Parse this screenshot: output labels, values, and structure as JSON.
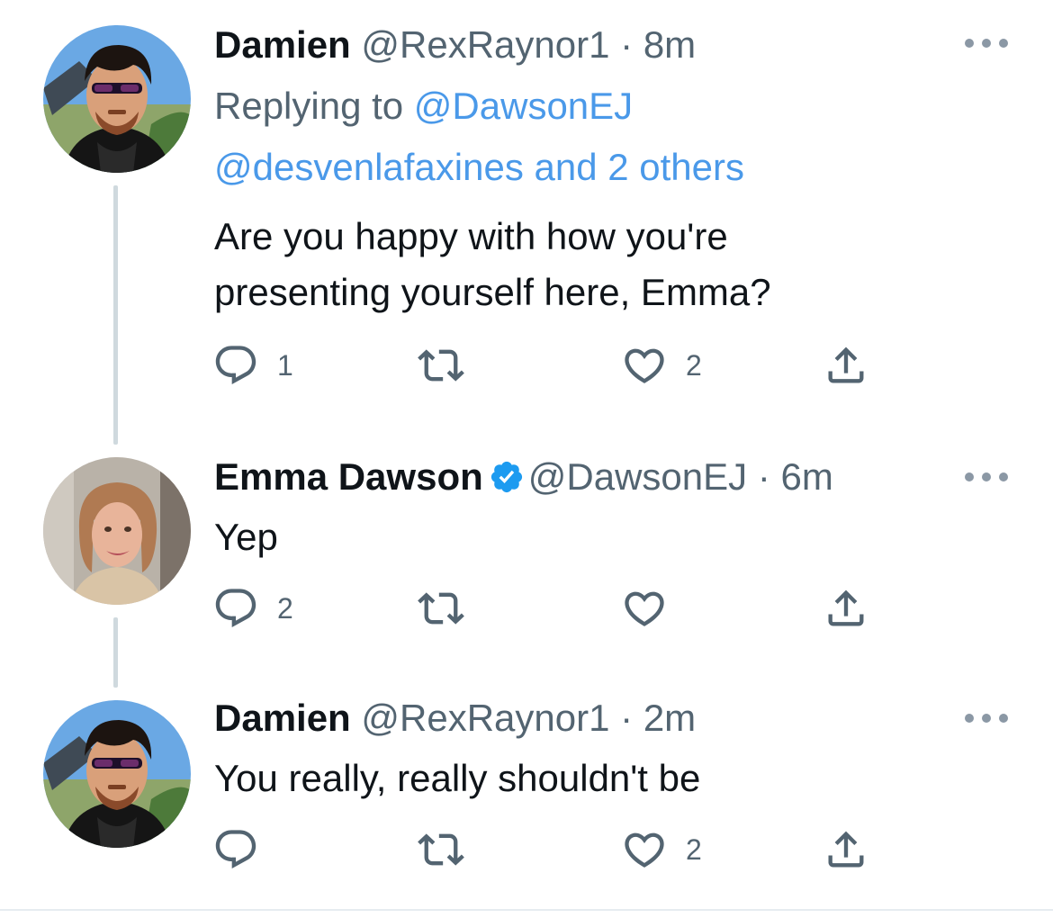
{
  "tweets": [
    {
      "name": "Damien",
      "handle": "@RexRaynor1",
      "separator": "·",
      "time": "8m",
      "verified": false,
      "avatar": "avatar-damien",
      "replying_prefix": "Replying to",
      "replying_to": "@DawsonEJ",
      "replying_more": "@desvenlafaxines and 2 others",
      "text_lines": [
        "Are you happy with how you're",
        "presenting yourself here, Emma?"
      ],
      "reply_count": "1",
      "retweet_count": "",
      "like_count": "2"
    },
    {
      "name": "Emma Dawson",
      "handle": "@DawsonEJ",
      "separator": "·",
      "time": "6m",
      "verified": true,
      "avatar": "avatar-emma",
      "text_lines": [
        "Yep"
      ],
      "reply_count": "2",
      "retweet_count": "",
      "like_count": ""
    },
    {
      "name": "Damien",
      "handle": "@RexRaynor1",
      "separator": "·",
      "time": "2m",
      "verified": false,
      "avatar": "avatar-damien",
      "text_lines": [
        "You really, really shouldn't be"
      ],
      "reply_count": "",
      "retweet_count": "",
      "like_count": "2"
    }
  ],
  "icons": {
    "reply": "speech-bubble-icon",
    "retweet": "retweet-icon",
    "like": "heart-icon",
    "share": "share-upload-icon",
    "more": "more-horizontal-icon",
    "verified": "verified-badge-icon"
  },
  "colors": {
    "link": "#4a99e9",
    "secondary_text": "#536471",
    "primary_text": "#0f1419",
    "verified": "#1d9bf0",
    "thread_line": "#cfd9de"
  }
}
